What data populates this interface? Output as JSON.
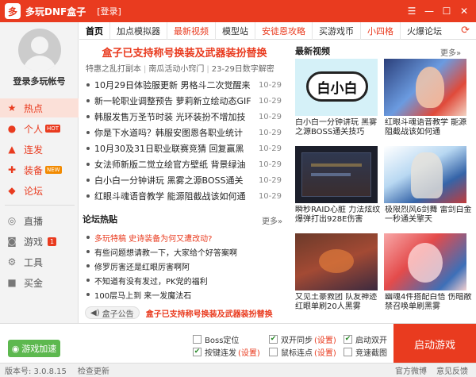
{
  "titlebar": {
    "title": "多玩DNF盒子",
    "login": "[登录]",
    "logo_char": "多"
  },
  "sidebar": {
    "account_label": "登录多玩帐号",
    "items": [
      {
        "label": "热点",
        "icon": "star-icon"
      },
      {
        "label": "个人",
        "badge": "HOT",
        "icon": "user-icon"
      },
      {
        "label": "连发",
        "icon": "rapid-fire-icon"
      },
      {
        "label": "装备",
        "badge": "NEW",
        "icon": "equipment-icon"
      },
      {
        "label": "论坛",
        "icon": "forum-icon"
      },
      {
        "label": "直播",
        "icon": "live-icon"
      },
      {
        "label": "游戏",
        "badge": "1",
        "icon": "gamepad-icon"
      },
      {
        "label": "工具",
        "icon": "tool-icon"
      },
      {
        "label": "买金",
        "icon": "gold-icon"
      }
    ]
  },
  "tabs": [
    "首页",
    "加点模拟器",
    "最新视频",
    "模型站",
    "安徒恩攻略",
    "买游戏币",
    "小四格",
    "火爆论坛"
  ],
  "news": {
    "headline": "盒子已支持称号换装及武器装扮替换",
    "subheads": [
      "特惠之乱打副本",
      "南瓜活动小窍门",
      "23-29日数字解密"
    ],
    "items": [
      {
        "title": "10月29日体验服更新 男格斗二次觉醒来",
        "date": "10-29"
      },
      {
        "title": "新一轮职业调整预告 萝莉新立绘动态GIF",
        "date": "10-29"
      },
      {
        "title": "韩服发售万圣节时装 光环装扮不增加技",
        "date": "10-29"
      },
      {
        "title": "你是下水道吗？韩服安图恩各职业统计",
        "date": "10-29"
      },
      {
        "title": "10月30及31日职业联赛竞猜 回复赢黑",
        "date": "10-29"
      },
      {
        "title": "女法师新版二觉立绘官方壁纸 背景绿油",
        "date": "10-29"
      },
      {
        "title": "白小白一分钟讲玩 黑雾之源BOSS通关",
        "date": "10-29"
      },
      {
        "title": "红眼斗魂语音教学 能源阻截战该如何通",
        "date": "10-29"
      }
    ]
  },
  "forum": {
    "title": "论坛热贴",
    "more": "更多»",
    "items": [
      "多玩特稿 史诗装备为何又遭改动?",
      "有些问题想请教一下，大家给个好答案啊",
      "修罗厉害还是红眼厉害啊阿",
      "不知道有没有发过，PK党的福利",
      "100层马上到 来一发魔法石"
    ]
  },
  "notice": {
    "button": "盒子公告",
    "text": "盒子已支持称号换装及武器装扮替换"
  },
  "videos": {
    "title": "最新视频",
    "more": "更多»",
    "items": [
      {
        "caption": "白小白一分钟讲玩 黑雾之源BOSS通关技巧",
        "thumb_text": "白小白"
      },
      {
        "caption": "红眼斗魂语音教学 能源阻截战该如何通"
      },
      {
        "caption": "瞬秒RAID心脏 力法炫纹爆弹打出928E伤害"
      },
      {
        "caption": "极限烈风6剑舞 雷剑白金 一秒通关擎天"
      },
      {
        "caption": "又见土豪救团 队友神迹红眼单刷20人黑雾"
      },
      {
        "caption": "幽魂4件搭配白悟 伤暗敝禁召唤单刷黑雾"
      }
    ]
  },
  "options": {
    "boss": "Boss定位",
    "hotkey": "按键连发",
    "dual": "双开同步",
    "click": "鼠标连点",
    "launch_dual": "启动双开",
    "screenshot": "竞速截图",
    "settings": "(设置)"
  },
  "buttons": {
    "speed": "游戏加速",
    "launch": "启动游戏"
  },
  "status": {
    "version": "版本号: 3.0.8.15",
    "check": "检查更新",
    "weibo": "官方微博",
    "feedback": "意见反馈"
  },
  "window": {
    "min": "—",
    "max": "☐",
    "close": "✕",
    "settings": "☰"
  }
}
